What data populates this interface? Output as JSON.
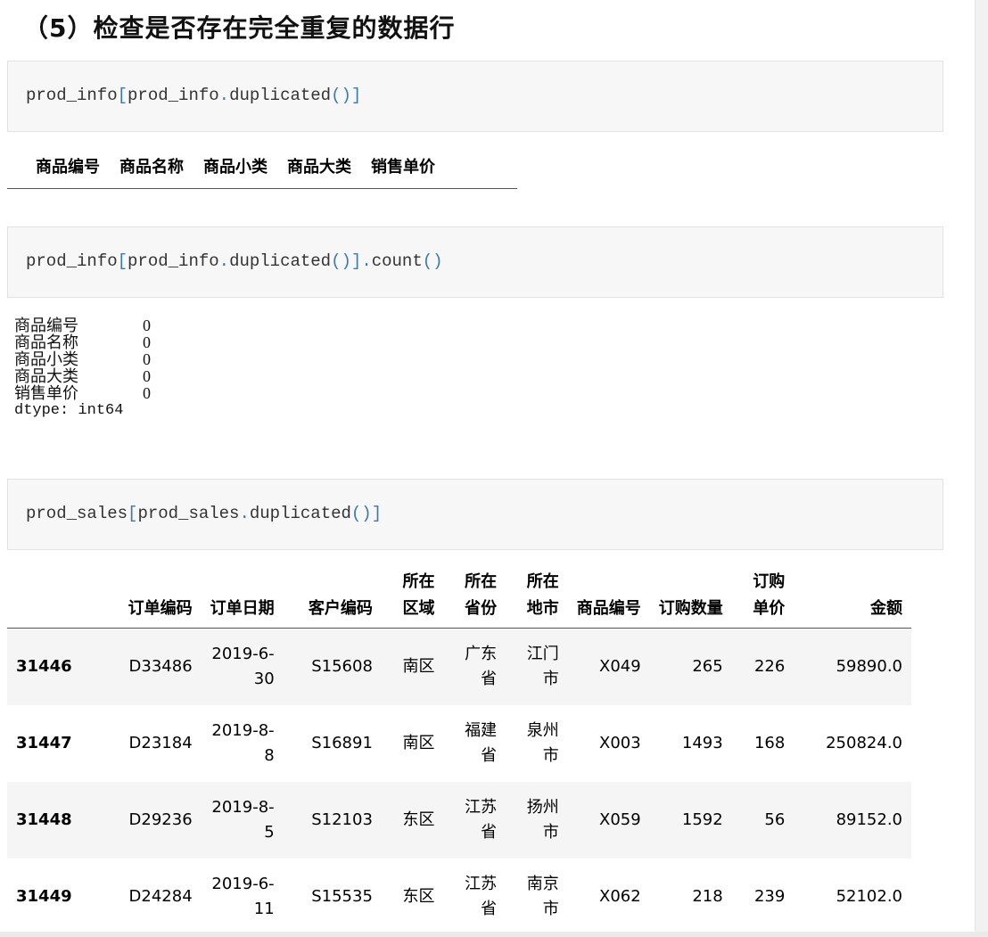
{
  "heading": "（5）检查是否存在完全重复的数据行",
  "cells": [
    {
      "code": [
        "prod_info",
        "[",
        "prod_info",
        ".",
        "duplicated",
        "()",
        "]"
      ]
    },
    {
      "code": [
        "prod_info",
        "[",
        "prod_info",
        ".",
        "duplicated",
        "()",
        "]",
        ".",
        "count",
        "()"
      ]
    },
    {
      "code": [
        "prod_sales",
        "[",
        "prod_sales",
        ".",
        "duplicated",
        "()",
        "]"
      ]
    }
  ],
  "empty_df_columns": [
    "商品编号",
    "商品名称",
    "商品小类",
    "商品大类",
    "销售单价"
  ],
  "series": {
    "rows": [
      {
        "key": "商品编号",
        "value": "0"
      },
      {
        "key": "商品名称",
        "value": "0"
      },
      {
        "key": "商品小类",
        "value": "0"
      },
      {
        "key": "商品大类",
        "value": "0"
      },
      {
        "key": "销售单价",
        "value": "0"
      }
    ],
    "dtype": "dtype: int64"
  },
  "sales_table": {
    "columns": [
      "",
      "订单编码",
      "订单日期",
      "客户编码",
      "所在区域",
      "所在省份",
      "所在地市",
      "商品编号",
      "订购数量",
      "订购单价",
      "金额"
    ],
    "rows": [
      [
        "31446",
        "D33486",
        "2019-6-30",
        "S15608",
        "南区",
        "广东省",
        "江门市",
        "X049",
        "265",
        "226",
        "59890.0"
      ],
      [
        "31447",
        "D23184",
        "2019-8-8",
        "S16891",
        "南区",
        "福建省",
        "泉州市",
        "X003",
        "1493",
        "168",
        "250824.0"
      ],
      [
        "31448",
        "D29236",
        "2019-8-5",
        "S12103",
        "东区",
        "江苏省",
        "扬州市",
        "X059",
        "1592",
        "56",
        "89152.0"
      ],
      [
        "31449",
        "D24284",
        "2019-6-11",
        "S15535",
        "东区",
        "江苏省",
        "南京市",
        "X062",
        "218",
        "239",
        "52102.0"
      ]
    ]
  }
}
